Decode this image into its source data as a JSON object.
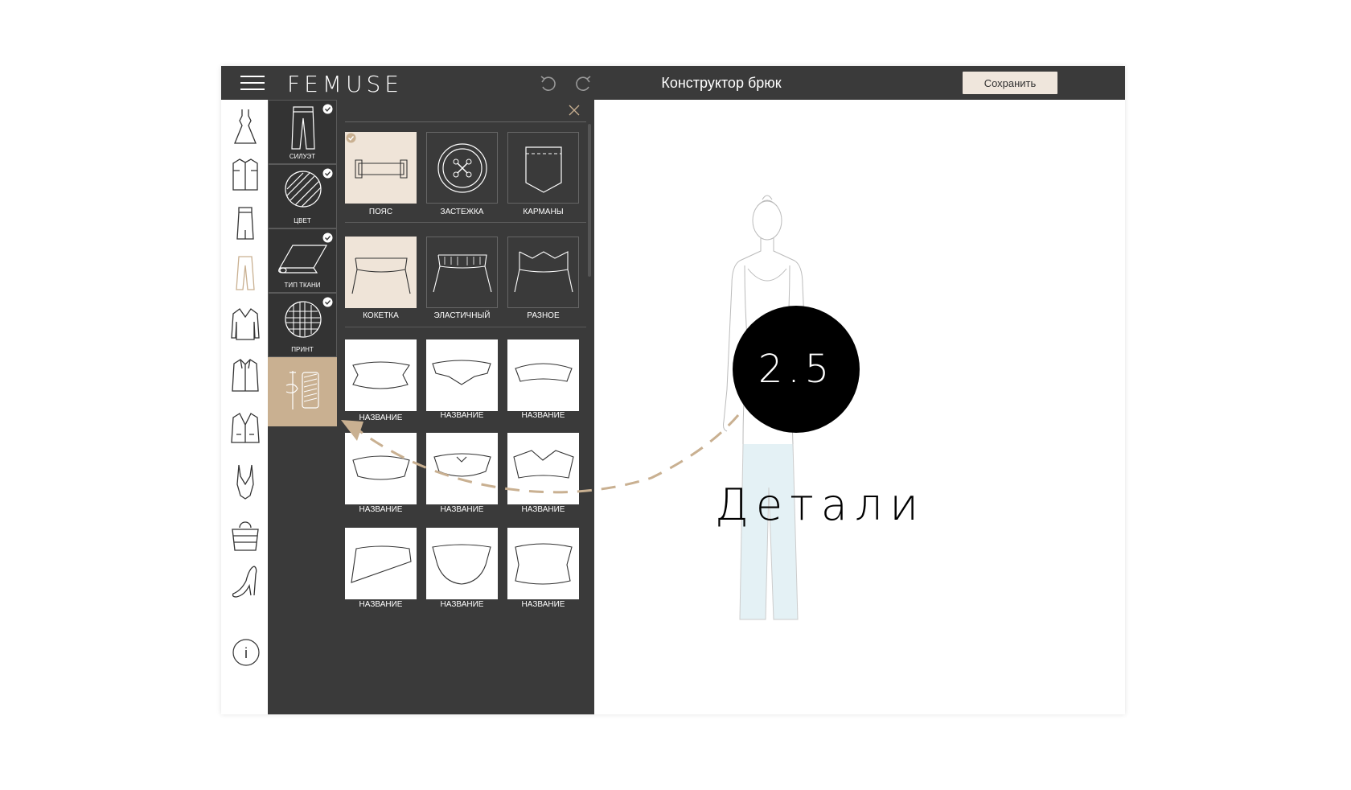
{
  "header": {
    "brand": "FEMUSE",
    "title": "Конструктор брюк",
    "save_label": "Сохранить"
  },
  "left_rail": {
    "items": [
      "dress-icon",
      "shirt-icon",
      "skirt-icon",
      "trousers-icon",
      "sweater-icon",
      "coat-icon",
      "jacket-icon",
      "swimsuit-icon",
      "bag-icon",
      "shoe-icon"
    ],
    "active": "trousers-icon",
    "info_label": "i"
  },
  "categories": [
    {
      "label": "СИЛУЭТ",
      "checked": true
    },
    {
      "label": "ЦВЕТ",
      "checked": true
    },
    {
      "label": "ТИП ТКАНИ",
      "checked": true
    },
    {
      "label": "ПРИНТ",
      "checked": true
    },
    {
      "label": "",
      "active": true
    }
  ],
  "detail_types": [
    {
      "label": "ПОЯС",
      "selected": true,
      "checked": true
    },
    {
      "label": "ЗАСТЕЖКА",
      "selected": false
    },
    {
      "label": "КАРМАНЫ",
      "selected": false
    }
  ],
  "waist_types": [
    {
      "label": "КОКЕТКА",
      "selected": true
    },
    {
      "label": "ЭЛАСТИЧНЫЙ",
      "selected": false
    },
    {
      "label": "РАЗНОЕ",
      "selected": false
    }
  ],
  "variants": [
    {
      "label": "НАЗВАНИЕ"
    },
    {
      "label": "НАЗВАНИЕ"
    },
    {
      "label": "НАЗВАНИЕ"
    },
    {
      "label": "НАЗВАНИЕ"
    },
    {
      "label": "НАЗВАНИЕ"
    },
    {
      "label": "НАЗВАНИЕ"
    },
    {
      "label": "НАЗВАНИЕ"
    },
    {
      "label": "НАЗВАНИЕ"
    },
    {
      "label": "НАЗВАНИЕ"
    }
  ],
  "overlay": {
    "step": "2.5",
    "caption": "Детали"
  },
  "colors": {
    "bar": "#3a3a3a",
    "accent": "#c9b091",
    "selected_tile": "#efe4d8",
    "trousers_fill": "#e4f1f5"
  }
}
